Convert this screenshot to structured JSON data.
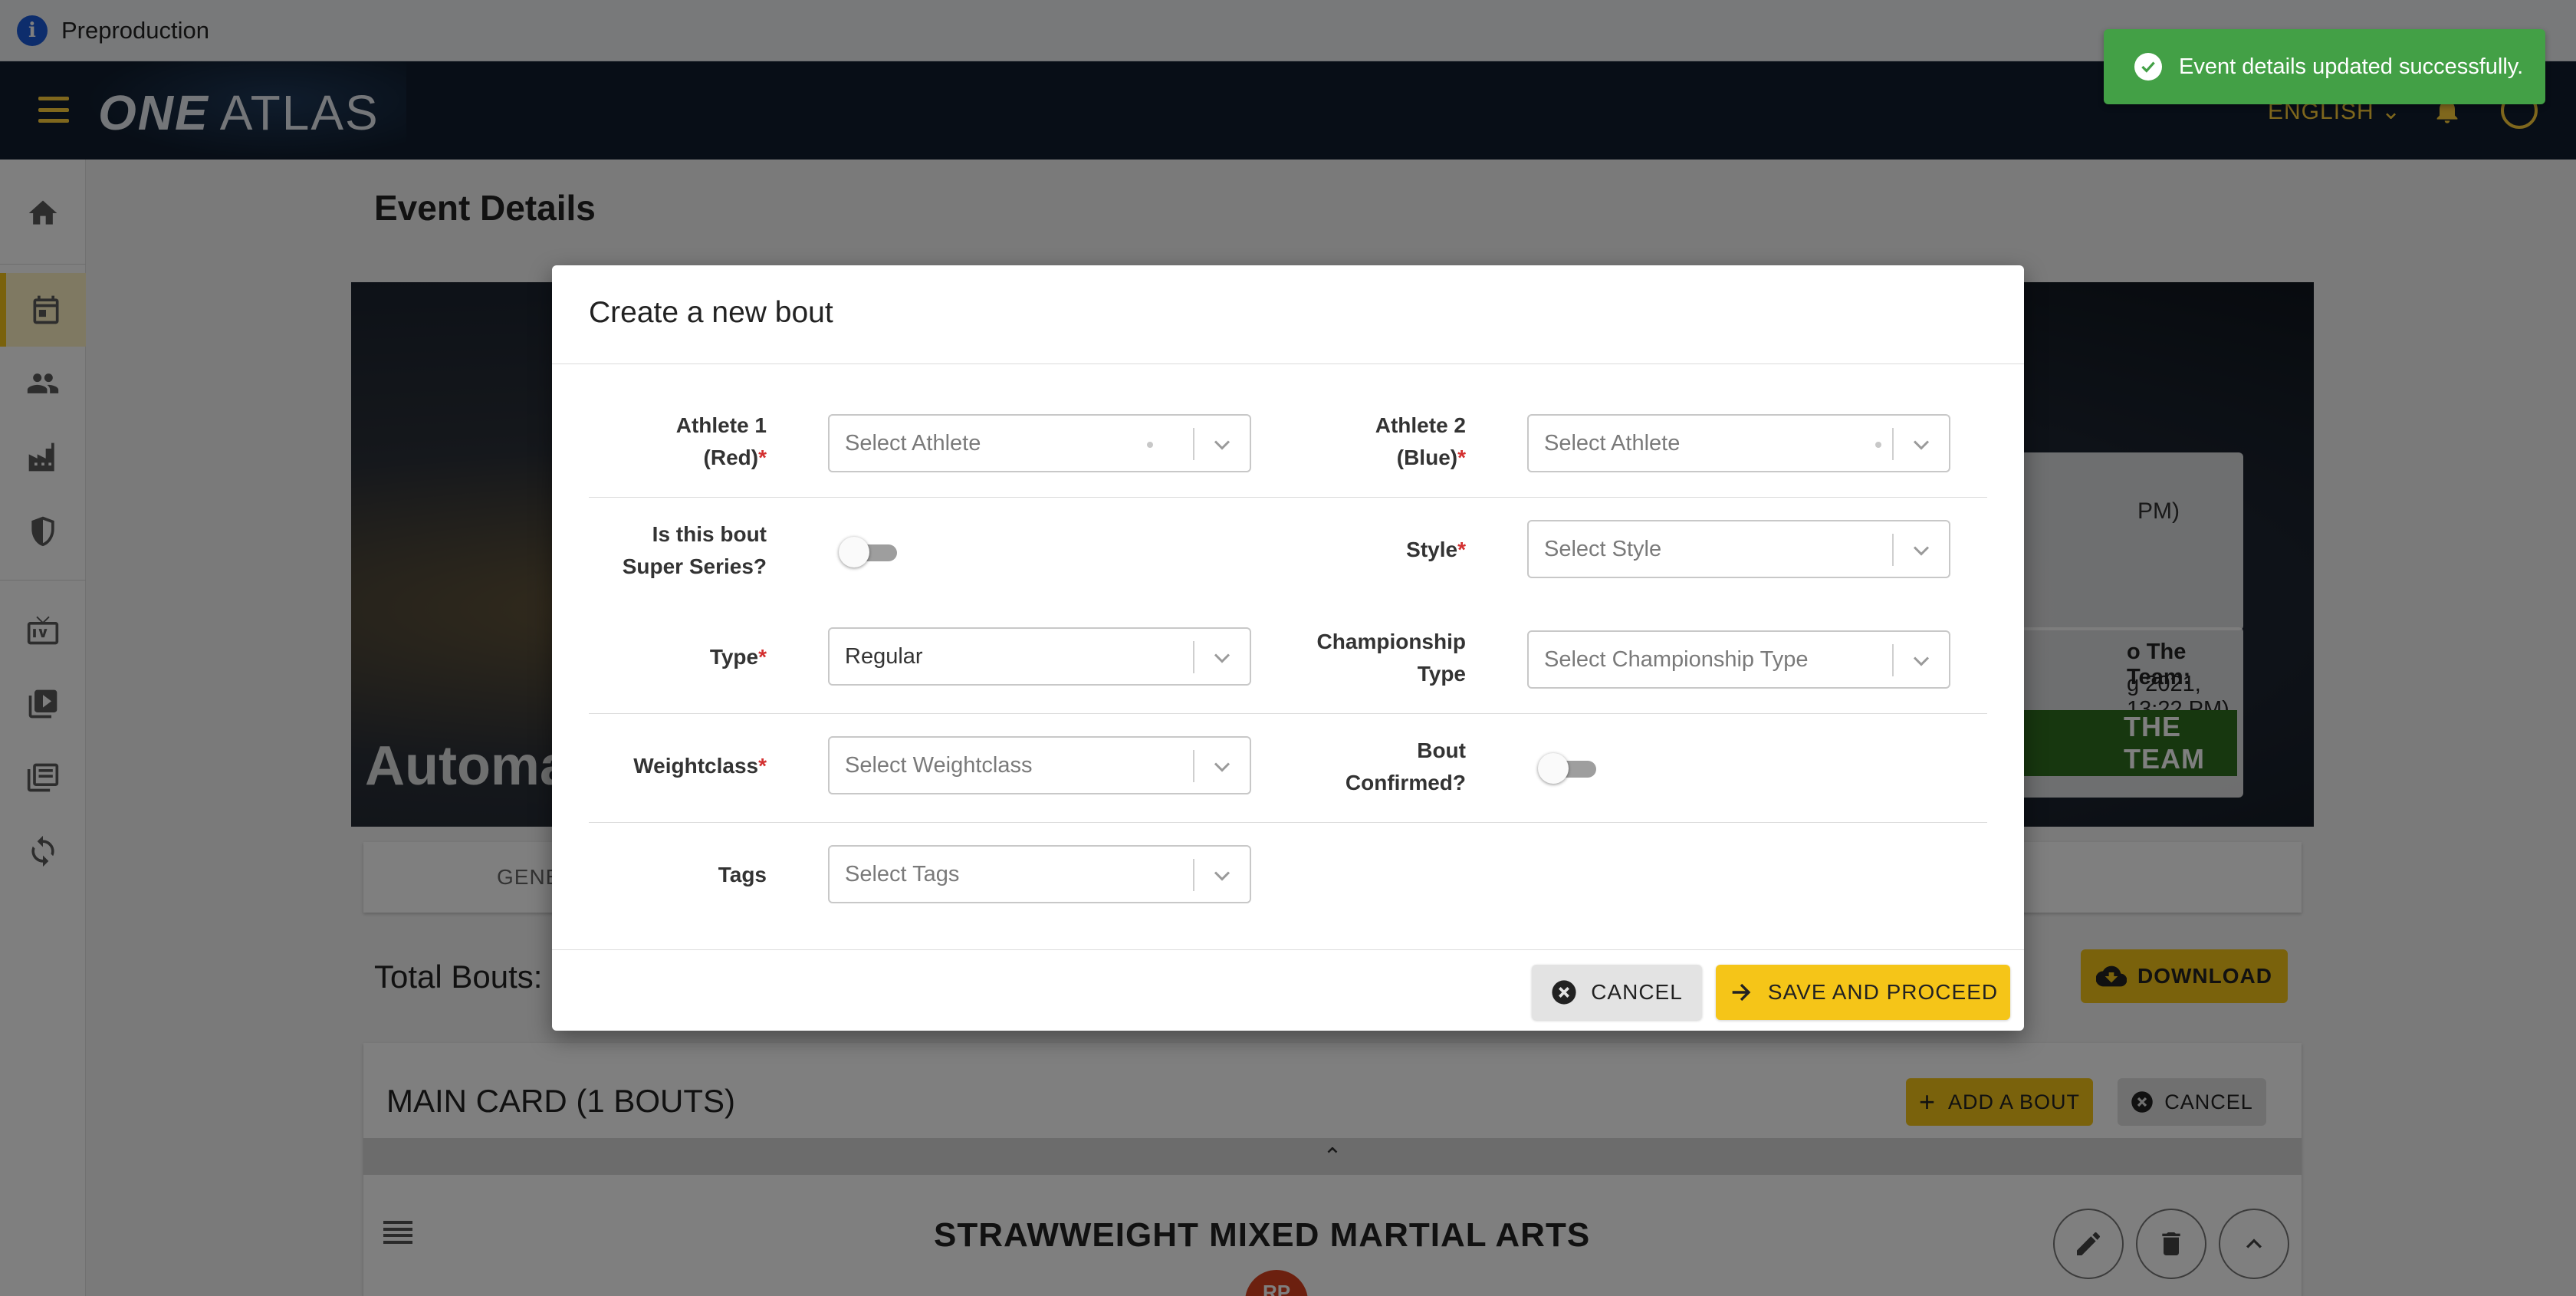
{
  "env": {
    "label": "Preproduction"
  },
  "nav": {
    "logo_one": "ONE",
    "logo_atlas": "ATLAS",
    "language": "ENGLISH"
  },
  "toast": {
    "message": "Event details updated successfully."
  },
  "page": {
    "title": "Event Details",
    "banner_title": "Automa",
    "info_time": "PM)",
    "team_label": "o The Team:",
    "team_date": "g 2021, 13:22 PM)",
    "team_button": "THE TEAM",
    "tab_general": "GENE",
    "total_bouts": "Total Bouts:",
    "download_label": "DOWNLOAD"
  },
  "main_card": {
    "title": "MAIN CARD (1 BOUTS)",
    "add_bout_label": "ADD A BOUT",
    "cancel_label": "CANCEL",
    "bout_title": "STRAWWEIGHT  MIXED MARTIAL ARTS",
    "avatar_initials": "RP"
  },
  "dialog": {
    "title": "Create a new bout",
    "athlete1": {
      "label_line1": "Athlete 1",
      "label_line2": "(Red)",
      "required": "*",
      "placeholder": "Select Athlete"
    },
    "athlete2": {
      "label_line1": "Athlete 2",
      "label_line2": "(Blue)",
      "required": "*",
      "placeholder": "Select Athlete"
    },
    "super_series": {
      "label_line1": "Is this bout",
      "label_line2": "Super Series?",
      "on": false
    },
    "style": {
      "label": "Style",
      "required": "*",
      "placeholder": "Select Style"
    },
    "type": {
      "label": "Type",
      "required": "*",
      "value": "Regular"
    },
    "championship": {
      "label_line1": "Championship",
      "label_line2": "Type",
      "placeholder": "Select Championship Type"
    },
    "weightclass": {
      "label": "Weightclass",
      "required": "*",
      "placeholder": "Select Weightclass"
    },
    "bout_confirmed": {
      "label_line1": "Bout",
      "label_line2": "Confirmed?",
      "on": false
    },
    "tags": {
      "label": "Tags",
      "placeholder": "Select Tags"
    },
    "cancel_label": "CANCEL",
    "save_label": "SAVE AND PROCEED"
  },
  "colors": {
    "accent": "#f5c518",
    "toast": "#43a046",
    "nav": "#101d2e",
    "required": "#d32f2f"
  }
}
